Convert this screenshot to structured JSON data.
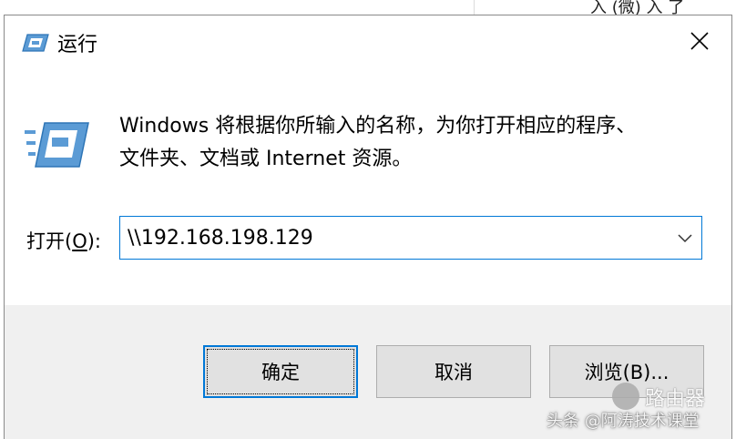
{
  "background": {
    "text": "入 (微) 入 了"
  },
  "window": {
    "title": "运行",
    "icons": {
      "app": "run-icon",
      "close": "close-icon",
      "dropdown": "chevron-down-icon"
    }
  },
  "content": {
    "description_line1": "Windows 将根据你所输入的名称，为你打开相应的程序、",
    "description_line2": "文件夹、文档或 Internet 资源。",
    "open_label_prefix": "打开(",
    "open_label_accel": "O",
    "open_label_suffix": "):",
    "input_value": "\\\\192.168.198.129"
  },
  "buttons": {
    "ok": "确定",
    "cancel": "取消",
    "browse": "浏览(B)..."
  },
  "watermark": {
    "brand": "路由器",
    "text": "头条 @阿涛技术课堂"
  },
  "colors": {
    "accent": "#0078d7",
    "footer": "#f0f0f0",
    "button": "#e1e1e1"
  }
}
